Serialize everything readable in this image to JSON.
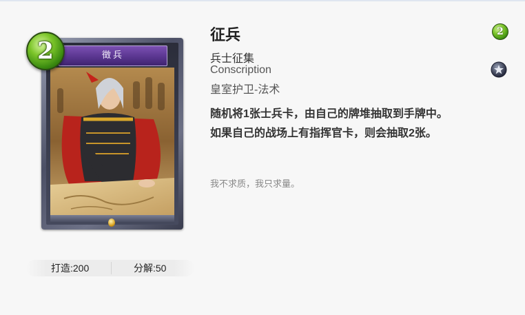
{
  "card": {
    "cost": "2",
    "frame_name": "徵兵",
    "title": "征兵",
    "chinese_name": "兵士征集",
    "english_name": "Conscription",
    "type_line": "皇室护卫-法术",
    "description": [
      "随机将1张士兵卡，由自己的牌堆抽取到手牌中。",
      "如果自己的战场上有指挥官卡，则会抽取2张。"
    ],
    "flavor": "我不求质，我只求量。",
    "rarity_icon": "star-badge-icon",
    "cost_color": "#6fbf25"
  },
  "stats": {
    "craft_label": "打造:200",
    "dismantle_label": "分解:50"
  }
}
